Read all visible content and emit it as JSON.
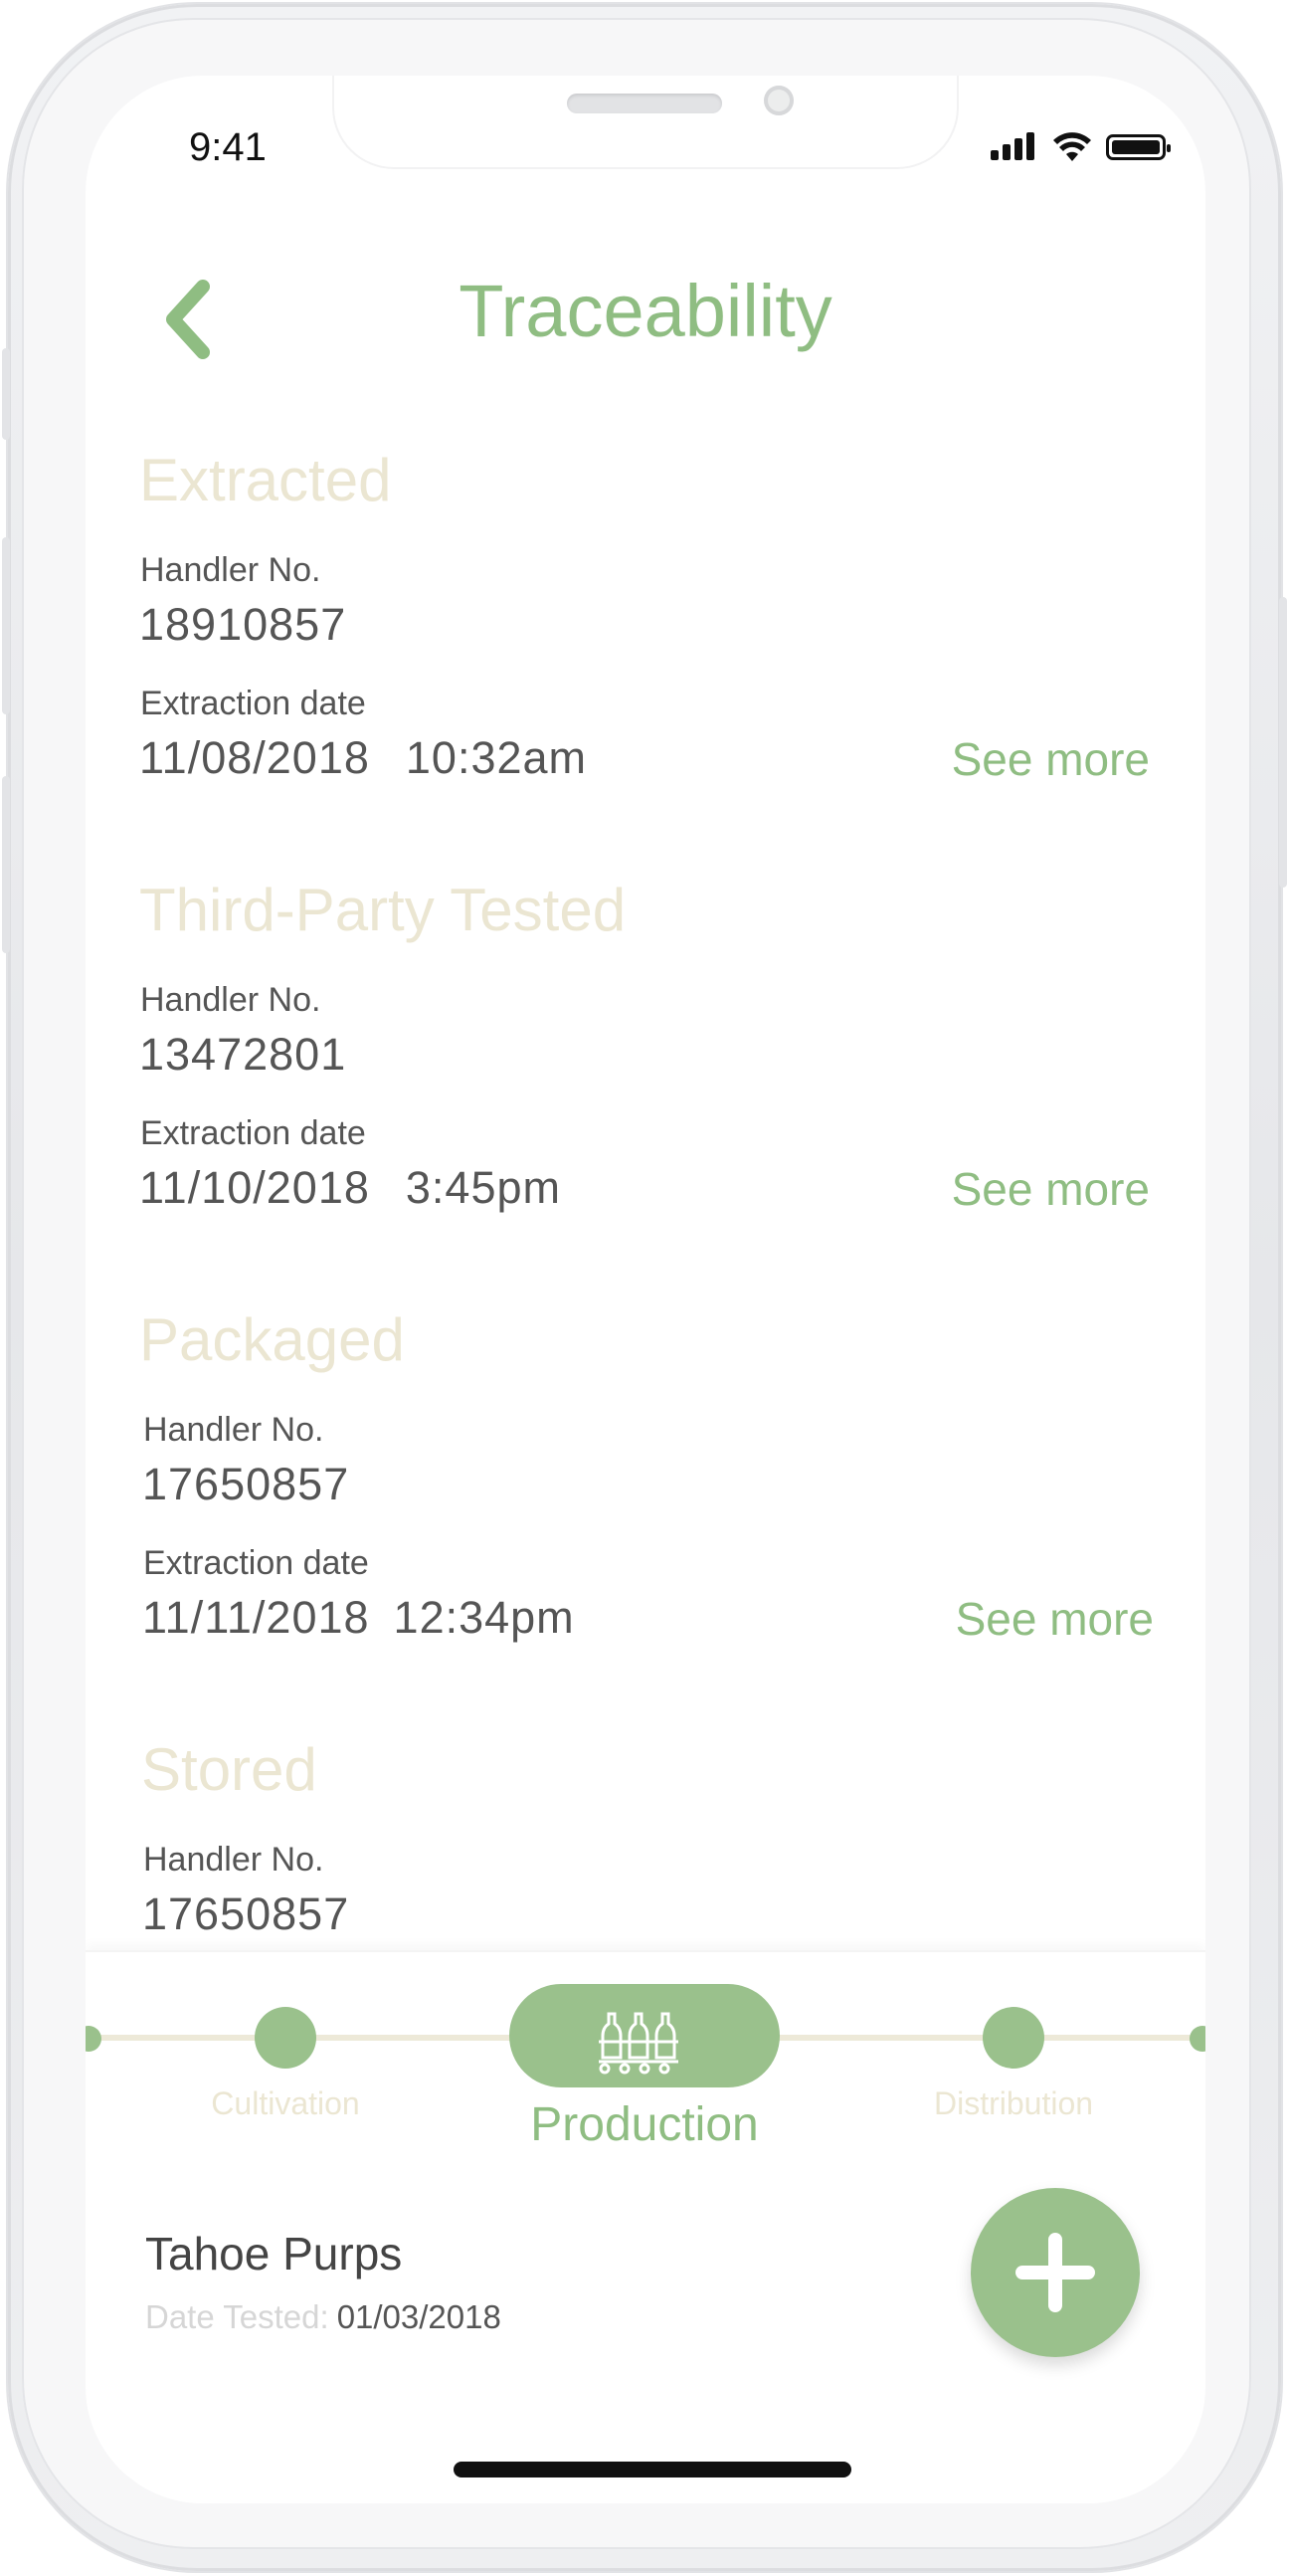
{
  "status_bar": {
    "time": "9:41"
  },
  "header": {
    "title": "Traceability"
  },
  "sections": [
    {
      "title": "Extracted",
      "handler_label": "Handler No.",
      "handler_value": "18910857",
      "date_label": "Extraction date",
      "date": "11/08/2018",
      "time": "10:32am",
      "see_more": "See more"
    },
    {
      "title": "Third-Party Tested",
      "handler_label": "Handler No.",
      "handler_value": "13472801",
      "date_label": "Extraction date",
      "date": "11/10/2018",
      "time": "3:45pm",
      "see_more": "See more"
    },
    {
      "title": "Packaged",
      "handler_label": "Handler No.",
      "handler_value": "17650857",
      "date_label": "Extraction date",
      "date": "11/11/2018",
      "time": "12:34pm",
      "see_more": "See more"
    },
    {
      "title": "Stored",
      "handler_label": "Handler No.",
      "handler_value": "17650857"
    }
  ],
  "timeline": {
    "steps": [
      "Cultivation",
      "Production",
      "Distribution"
    ],
    "active": "Production",
    "active_icon": "bottles-icon"
  },
  "product": {
    "name": "Tahoe Purps",
    "date_label": "Date Tested:",
    "date_value": "01/03/2018"
  },
  "colors": {
    "accent": "#8fbd82",
    "muted_title": "#ebe6d2",
    "text": "#555555"
  }
}
